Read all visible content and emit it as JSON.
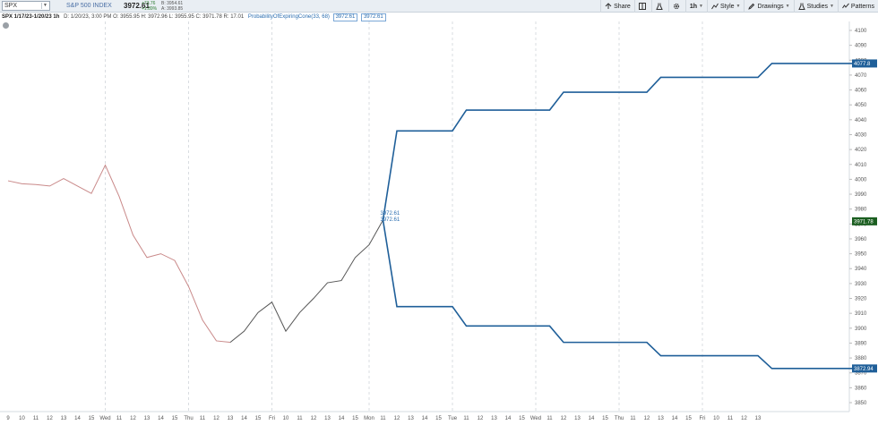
{
  "toolbar": {
    "symbol": "SPX",
    "description": "S&P 500 INDEX",
    "last": "3972.61",
    "change": "+73.76",
    "change_pct": "+1.89%",
    "bid": "B: 3954.61",
    "ask": "A: 3993.85",
    "share_label": "Share",
    "timeframe_label": "1h",
    "style_label": "Style",
    "drawings_label": "Drawings",
    "studies_label": "Studies",
    "patterns_label": "Patterns"
  },
  "info": {
    "title": "SPX 1/17/23-1/20/23 1h",
    "ohlc": "D: 1/20/23, 3:00 PM  O: 3955.95  H: 3972.96  L: 3955.95  C: 3971.78  R: 17.01",
    "study": "ProbabilityOfExpiringCone(33, 68)",
    "study_value_1": "3972.61",
    "study_value_2": "3972.61"
  },
  "chart_data": {
    "type": "line",
    "ylim": [
      3844,
      4106
    ],
    "y_ticks": [
      3850,
      3860,
      3870,
      3880,
      3890,
      3900,
      3910,
      3920,
      3930,
      3940,
      3950,
      3960,
      3970,
      3980,
      3990,
      4000,
      4010,
      4020,
      4030,
      4040,
      4050,
      4060,
      4070,
      4080,
      4090,
      4100
    ],
    "x_labels": [
      "9",
      "10",
      "11",
      "12",
      "13",
      "14",
      "15",
      "Wed",
      "11",
      "12",
      "13",
      "14",
      "15",
      "Thu",
      "11",
      "12",
      "13",
      "14",
      "15",
      "Fri",
      "10",
      "11",
      "12",
      "13",
      "14",
      "15",
      "Mon",
      "11",
      "12",
      "13",
      "14",
      "15",
      "Tue",
      "11",
      "12",
      "13",
      "14",
      "15",
      "Wed",
      "11",
      "12",
      "13",
      "14",
      "15",
      "Thu",
      "11",
      "12",
      "13",
      "14",
      "15",
      "Fri",
      "10",
      "11",
      "12",
      "13"
    ],
    "series": [
      {
        "values": [
          [
            0,
            3999
          ],
          [
            1,
            3997
          ],
          [
            2,
            3996.5
          ],
          [
            3,
            3995.5
          ],
          [
            4,
            4000.5
          ],
          [
            5,
            3995.5
          ],
          [
            6,
            3990.5
          ],
          [
            7,
            4009.5
          ],
          [
            8,
            3988.5
          ],
          [
            9,
            3962.5
          ],
          [
            10,
            3947.5
          ],
          [
            11,
            3950
          ],
          [
            12,
            3945.5
          ],
          [
            13,
            3928
          ],
          [
            14,
            3905.5
          ],
          [
            15,
            3891.5
          ],
          [
            16,
            3890.5
          ],
          [
            17,
            3898
          ],
          [
            18,
            3910.5
          ],
          [
            19,
            3917.5
          ],
          [
            20,
            3898
          ],
          [
            21,
            3910.5
          ],
          [
            22,
            3920
          ],
          [
            23,
            3930.5
          ],
          [
            24,
            3932
          ],
          [
            25,
            3947.5
          ],
          [
            26,
            3956
          ],
          [
            27,
            3972.6
          ]
        ],
        "color": "#c98989",
        "color_after_low": "#555555"
      },
      {
        "values": [
          [
            27,
            3972.61
          ],
          [
            28,
            4032.5
          ],
          [
            32,
            4032.5
          ],
          [
            33,
            4046.5
          ],
          [
            39,
            4046.5
          ],
          [
            40,
            4058.5
          ],
          [
            46,
            4058.5
          ],
          [
            47,
            4068.5
          ],
          [
            54,
            4068.5
          ],
          [
            55,
            4077.8
          ],
          [
            61,
            4077.8
          ]
        ],
        "color": "#1f5f99"
      },
      {
        "values": [
          [
            27,
            3972.61
          ],
          [
            28,
            3914.5
          ],
          [
            32,
            3914.5
          ],
          [
            33,
            3901.5
          ],
          [
            39,
            3901.5
          ],
          [
            40,
            3890.5
          ],
          [
            46,
            3890.5
          ],
          [
            47,
            3881.5
          ],
          [
            54,
            3881.5
          ],
          [
            55,
            3872.94
          ],
          [
            61,
            3872.94
          ]
        ],
        "color": "#1f5f99"
      }
    ],
    "price_pills": [
      {
        "value": 4077.8,
        "text": "4077.8",
        "color": "#1f5f99"
      },
      {
        "value": 3971.78,
        "text": "3971.78",
        "color": "#1b5e20"
      },
      {
        "value": 3872.94,
        "text": "3872.94",
        "color": "#1f5f99"
      }
    ]
  }
}
